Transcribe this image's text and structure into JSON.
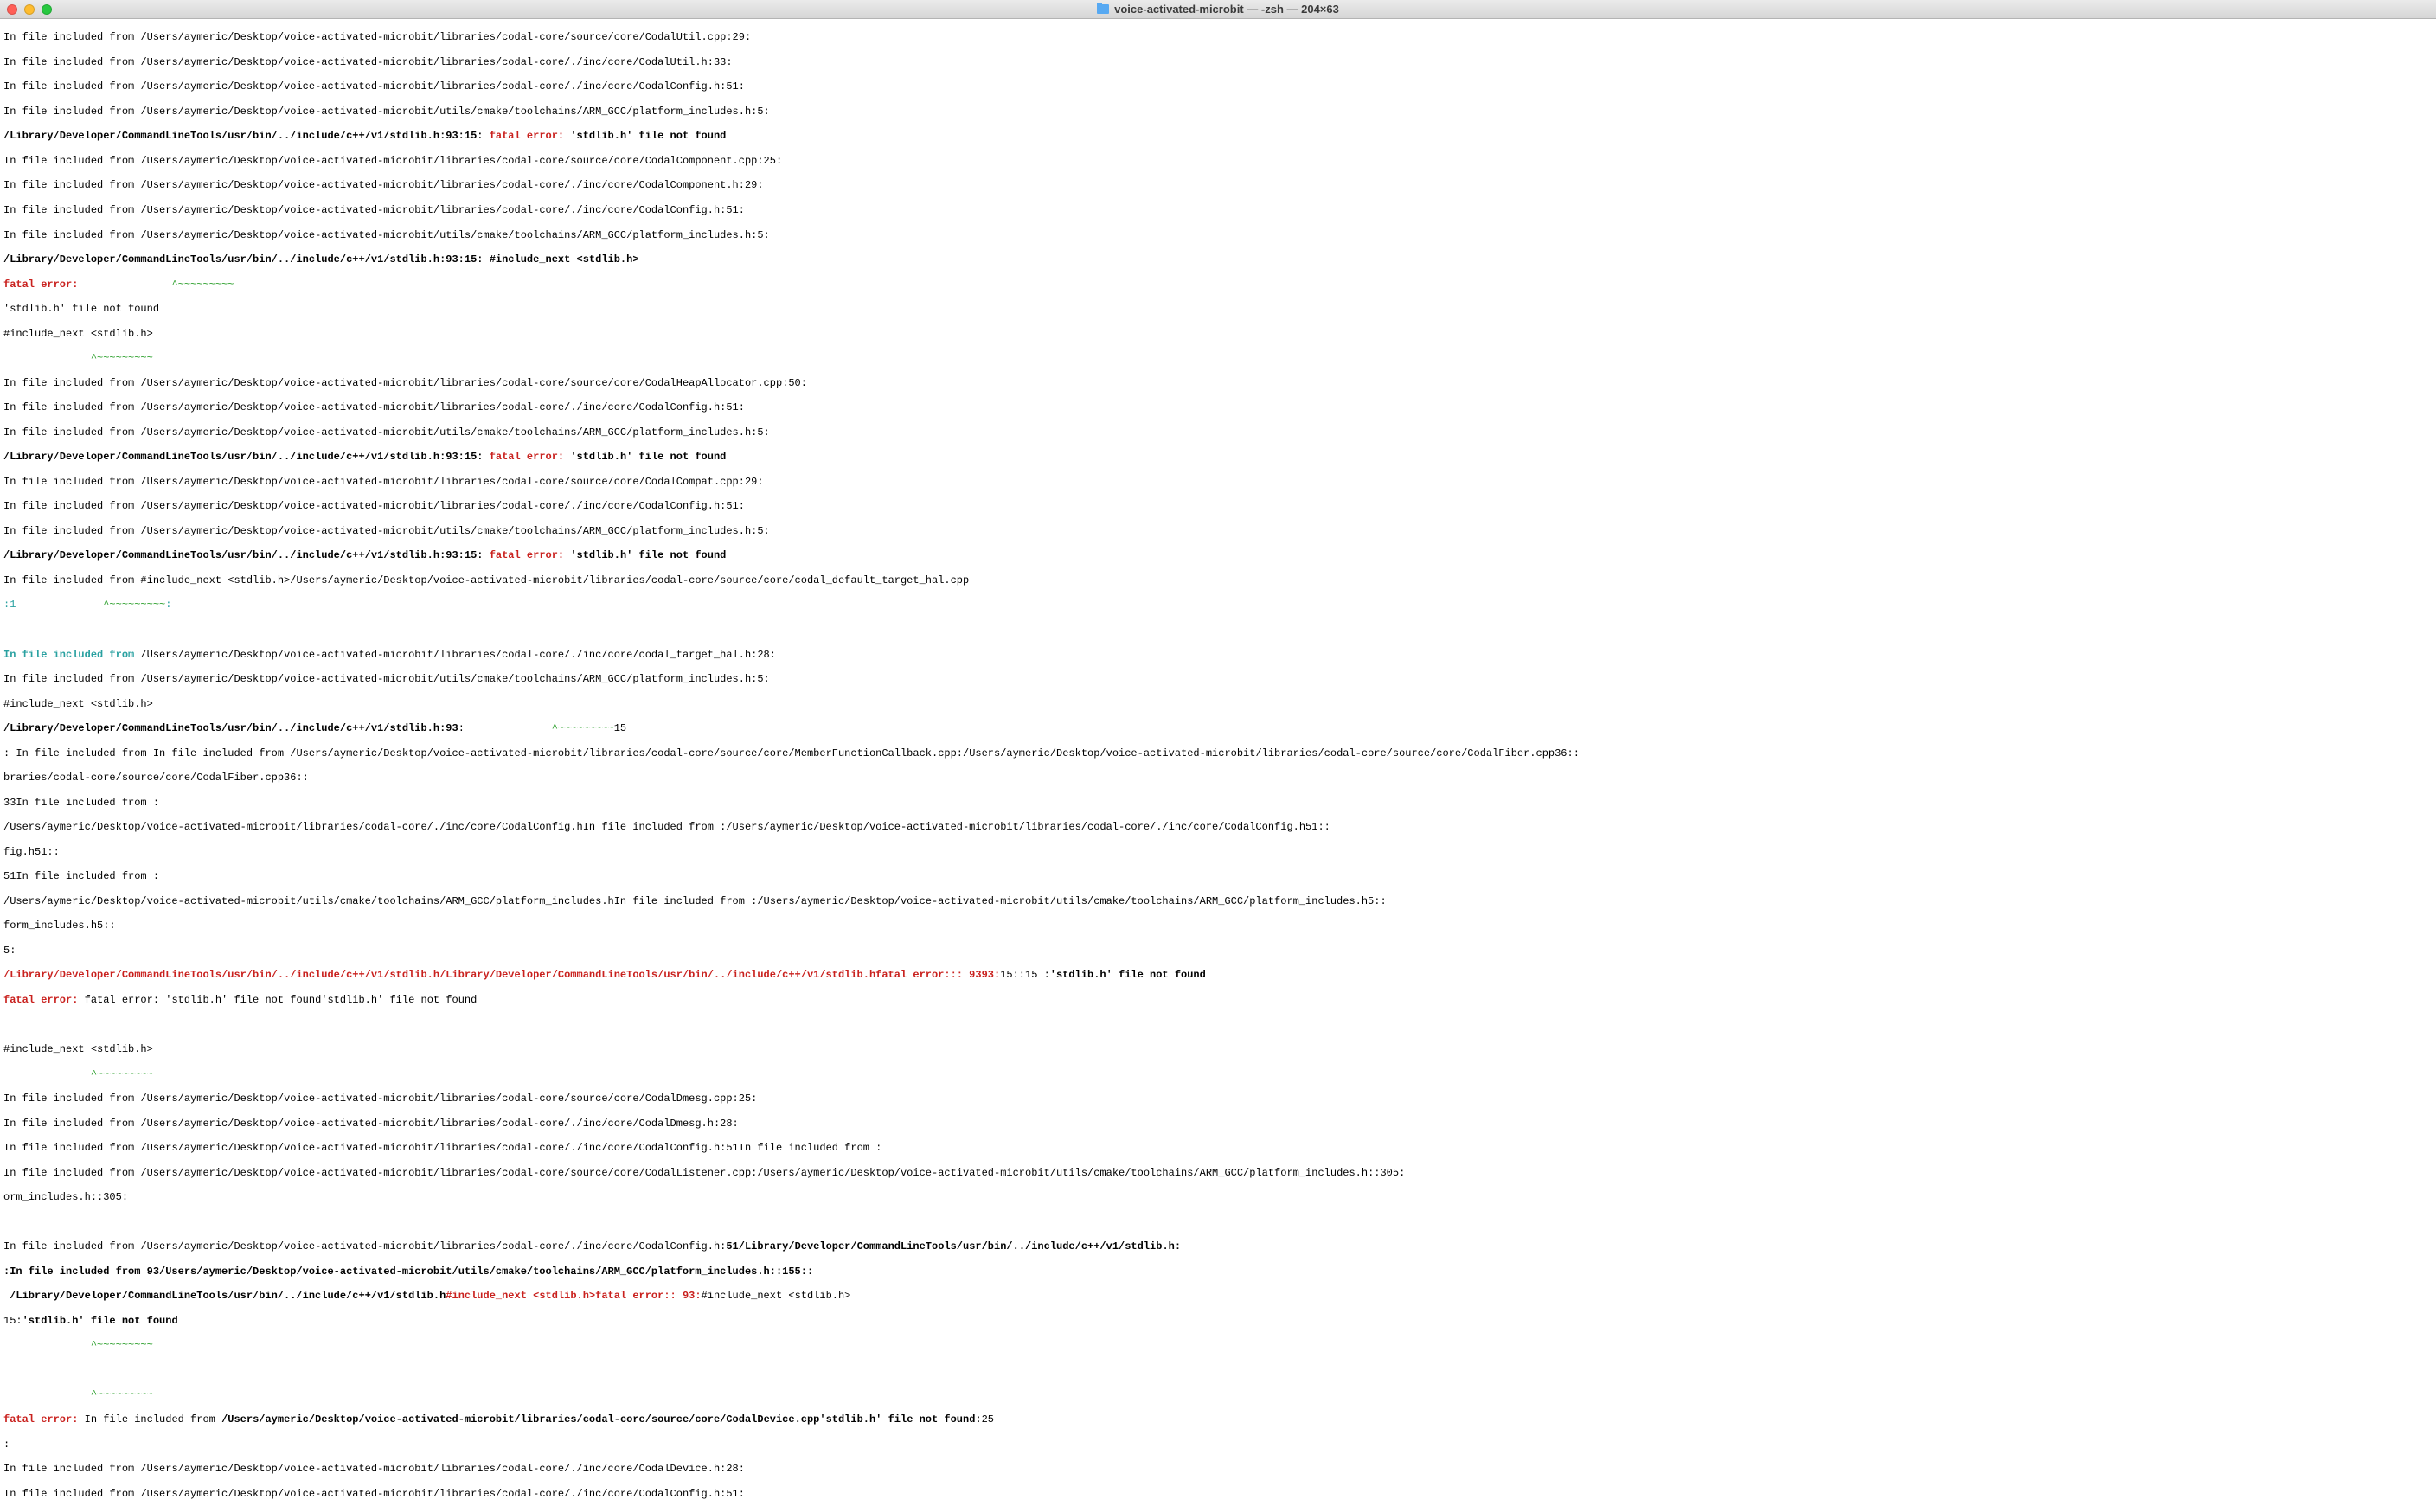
{
  "window": {
    "title": "voice-activated-microbit — -zsh — 204×63"
  },
  "l": {
    "t0a": "In file included from ",
    "t0b": "/Users/aymeric/Desktop/voice-activated-microbit/libraries/codal-core/source/core/CodalUtil.cpp:29:",
    "t1a": "In file included from ",
    "t1b": "/Users/aymeric/Desktop/voice-activated-microbit/libraries/codal-core/./inc/core/CodalUtil.h:33:",
    "t2a": "In file included from ",
    "t2b": "/Users/aymeric/Desktop/voice-activated-microbit/libraries/codal-core/./inc/core/CodalConfig.h:51:",
    "t3a": "In file included from ",
    "t3b": "/Users/aymeric/Desktop/voice-activated-microbit/utils/cmake/toolchains/ARM_GCC/platform_includes.h:5:",
    "t4a": "/Library/Developer/CommandLineTools/usr/bin/../include/c++/v1/stdlib.h:93:15: ",
    "t4b": "fatal error: ",
    "t4c": "'stdlib.h' file not found",
    "t5a": "In file included from ",
    "t5b": "/Users/aymeric/Desktop/voice-activated-microbit/libraries/codal-core/source/core/CodalComponent.cpp:25:",
    "t6a": "In file included from ",
    "t6b": "/Users/aymeric/Desktop/voice-activated-microbit/libraries/codal-core/./inc/core/CodalComponent.h:29:",
    "t7a": "In file included from ",
    "t7b": "/Users/aymeric/Desktop/voice-activated-microbit/libraries/codal-core/./inc/core/CodalConfig.h:51:",
    "t8a": "In file included from ",
    "t8b": "/Users/aymeric/Desktop/voice-activated-microbit/utils/cmake/toolchains/ARM_GCC/platform_includes.h:5:",
    "t9a": "/Library/Developer/CommandLineTools/usr/bin/../include/c++/v1/stdlib.h:93:15: #include_next <stdlib.h>",
    "t10": "fatal error: ",
    "t10b": "              ^~~~~~~~~~",
    "t11": "'stdlib.h' file not found",
    "t12": "#include_next <stdlib.h>",
    "t13": "              ^~~~~~~~~~",
    "t14a": "In file included from ",
    "t14b": "/Users/aymeric/Desktop/voice-activated-microbit/libraries/codal-core/source/core/CodalHeapAllocator.cpp:50:",
    "t15a": "In file included from ",
    "t15b": "/Users/aymeric/Desktop/voice-activated-microbit/libraries/codal-core/./inc/core/CodalConfig.h:51:",
    "t16a": "In file included from ",
    "t16b": "/Users/aymeric/Desktop/voice-activated-microbit/utils/cmake/toolchains/ARM_GCC/platform_includes.h:5:",
    "t17a": "/Library/Developer/CommandLineTools/usr/bin/../include/c++/v1/stdlib.h:93:15: ",
    "t17b": "fatal error: ",
    "t17c": "'stdlib.h' file not found",
    "t18a": "In file included from ",
    "t18b": "/Users/aymeric/Desktop/voice-activated-microbit/libraries/codal-core/source/core/CodalCompat.cpp:29:",
    "t19a": "In file included from ",
    "t19b": "/Users/aymeric/Desktop/voice-activated-microbit/libraries/codal-core/./inc/core/CodalConfig.h:51:",
    "t20a": "In file included from ",
    "t20b": "/Users/aymeric/Desktop/voice-activated-microbit/utils/cmake/toolchains/ARM_GCC/platform_includes.h:5:",
    "t21a": "/Library/Developer/CommandLineTools/usr/bin/../include/c++/v1/stdlib.h:93:15: ",
    "t21b": "fatal error: ",
    "t21c": "'stdlib.h' file not found",
    "t22a": "In file included from #include_next <stdlib.h>",
    "t22b": "/Users/aymeric/Desktop/voice-activated-microbit/libraries/codal-core/source/core/codal_default_target_hal.cpp",
    "t23a": ":1",
    "t23b": "              ^~~~~~~~~~",
    "t23c": ":",
    "t24": " ",
    "t25a": "In file included from ",
    "t25b": "/Users/aymeric/Desktop/voice-activated-microbit/libraries/codal-core/./inc/core/codal_target_hal.h:28:",
    "t26a": "In file included from ",
    "t26b": "/Users/aymeric/Desktop/voice-activated-microbit/utils/cmake/toolchains/ARM_GCC/platform_includes.h:5:",
    "t27": "#include_next <stdlib.h>",
    "t28a": "/Library/Developer/CommandLineTools/usr/bin/../include/c++/v1/stdlib.h:93",
    "t28b": ":",
    "t28c": "              ^~~~~~~~~~",
    "t28d": "15",
    "t29a": ": ",
    "t29b": "In file included from In file included from ",
    "t29c": "/Users/aymeric/Desktop/voice-activated-microbit/libraries/codal-core/source/core/MemberFunctionCallback.cpp:/Users/aymeric/Desktop/voice-activated-microbit/libraries/codal-core/source/core/CodalFiber.cpp36::",
    "t30": "braries/codal-core/source/core/CodalFiber.cpp36::",
    "t31": "33In file included from :",
    "t32": "/Users/aymeric/Desktop/voice-activated-microbit/libraries/codal-core/./inc/core/CodalConfig.hIn file included from :/Users/aymeric/Desktop/voice-activated-microbit/libraries/codal-core/./inc/core/CodalConfig.h51::",
    "t33": "fig.h51::",
    "t34": "51In file included from :",
    "t35": "/Users/aymeric/Desktop/voice-activated-microbit/utils/cmake/toolchains/ARM_GCC/platform_includes.hIn file included from :/Users/aymeric/Desktop/voice-activated-microbit/utils/cmake/toolchains/ARM_GCC/platform_includes.h5::",
    "t36": "form_includes.h5::",
    "t37": "5:",
    "t38a": "/Library/Developer/CommandLineTools/usr/bin/../include/c++/v1/stdlib.h/Library/Developer/CommandLineTools/usr/bin/../include/c++/v1/stdlib.hfatal error::: 9393:",
    "t38b": "15::15 :",
    "t38c": "'stdlib.h' file not found",
    "t39a": "fatal error: ",
    "t39b": "fatal error: 'stdlib.h' file not found'stdlib.h' file not found",
    "t40": " ",
    "t41": "#include_next <stdlib.h>",
    "t42": "              ^~~~~~~~~~",
    "t43a": "In file included from ",
    "t43b": "/Users/aymeric/Desktop/voice-activated-microbit/libraries/codal-core/source/core/CodalDmesg.cpp:25:",
    "t44a": "In file included from ",
    "t44b": "/Users/aymeric/Desktop/voice-activated-microbit/libraries/codal-core/./inc/core/CodalDmesg.h:28:",
    "t45a": "In file included from ",
    "t45b": "/Users/aymeric/Desktop/voice-activated-microbit/libraries/codal-core/./inc/core/CodalConfig.h:51",
    "t45c": "In file included from :",
    "t46a": "In file included from ",
    "t46b": "/Users/aymeric/Desktop/voice-activated-microbit/libraries/codal-core/source/core/CodalListener.cpp:/Users/aymeric/Desktop/voice-activated-microbit/utils/cmake/toolchains/ARM_GCC/platform_includes.h::305:",
    "t47": "orm_includes.h::305:",
    "t48": " ",
    "t49a": "In file included from ",
    "t49b": "/Users/aymeric/Desktop/voice-activated-microbit/libraries/codal-core/./inc/core/CodalConfig.h:",
    "t49c": "51/Library/Developer/CommandLineTools/usr/bin/../include/c++/v1/stdlib.h:",
    "t50a": ":In file included from 93",
    "t50b": "/Users/aymeric/Desktop/voice-activated-microbit/utils/cmake/toolchains/ARM_GCC/platform_includes.h::155::",
    "t51a": " /Library/Developer/CommandLineTools/usr/bin/../include/c++/v1/stdlib.h",
    "t51b": "#include_next <stdlib.h>fatal error:: 93:",
    "t51c": "#include_next <stdlib.h>",
    "t52a": "15:",
    "t52b": "'stdlib.h' file not found",
    "t53": "              ^~~~~~~~~~",
    "t54": " ",
    "t55": "              ^~~~~~~~~~",
    "t56a": "fatal error: ",
    "t56b": "In file included from ",
    "t56c": "/Users/aymeric/Desktop/voice-activated-microbit/libraries/codal-core/source/core/CodalDevice.cpp",
    "t56d": "'stdlib.h' file not found:",
    "t56e": "25",
    "t57": ":",
    "t58a": "In file included from ",
    "t58b": "/Users/aymeric/Desktop/voice-activated-microbit/libraries/codal-core/./inc/core/CodalDevice.h:28:",
    "t59a": "In file included from ",
    "t59b": "/Users/aymeric/Desktop/voice-activated-microbit/libraries/codal-core/./inc/core/CodalConfig.h:51:"
  }
}
